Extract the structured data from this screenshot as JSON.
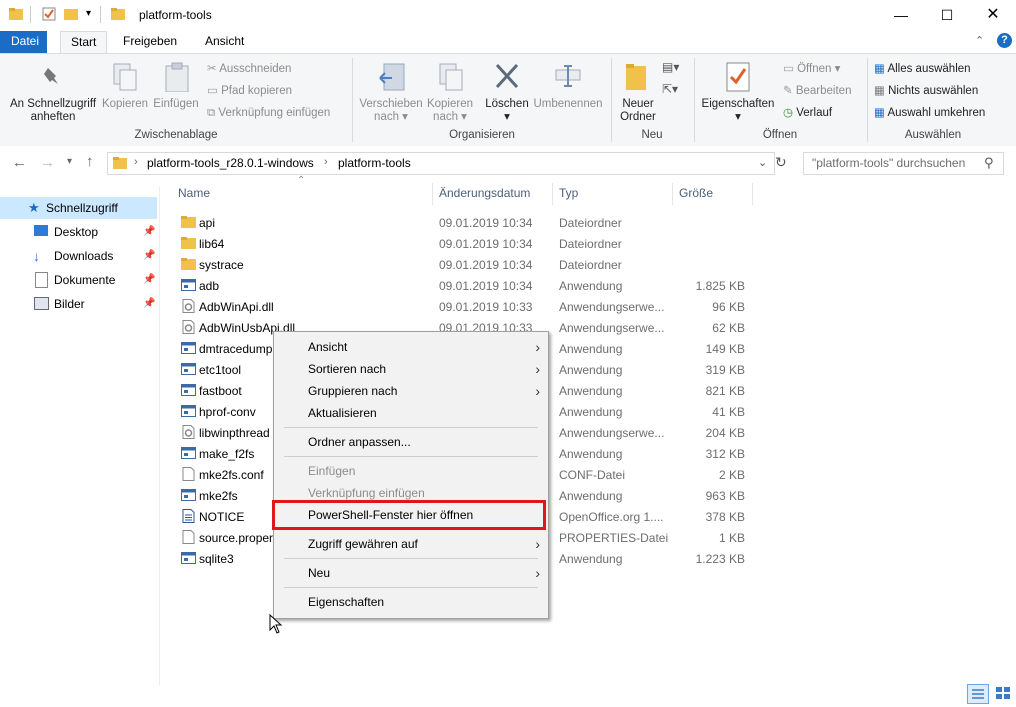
{
  "window": {
    "title": "platform-tools",
    "controls": {
      "minimize": "—",
      "maximize": "☐",
      "close": "✕"
    }
  },
  "ribbon_tabs": [
    "Datei",
    "Start",
    "Freigeben",
    "Ansicht"
  ],
  "ribbon": {
    "clipboard": {
      "pin_label_1": "An Schnellzugriff",
      "pin_label_2": "anheften",
      "copy": "Kopieren",
      "paste": "Einfügen",
      "cut": "Ausschneiden",
      "copy_path": "Pfad kopieren",
      "paste_shortcut": "Verknüpfung einfügen",
      "group": "Zwischenablage"
    },
    "organize": {
      "move_1": "Verschieben",
      "move_2": "nach",
      "copyto_1": "Kopieren",
      "copyto_2": "nach",
      "delete": "Löschen",
      "rename": "Umbenennen",
      "group": "Organisieren"
    },
    "new": {
      "folder_1": "Neuer",
      "folder_2": "Ordner",
      "group": "Neu"
    },
    "open": {
      "properties": "Eigenschaften",
      "open": "Öffnen",
      "edit": "Bearbeiten",
      "history": "Verlauf",
      "group": "Öffnen"
    },
    "select": {
      "all": "Alles auswählen",
      "none": "Nichts auswählen",
      "invert": "Auswahl umkehren",
      "group": "Auswählen"
    }
  },
  "address": {
    "crumbs": [
      "platform-tools_r28.0.1-windows",
      "platform-tools"
    ],
    "search_placeholder": "\"platform-tools\" durchsuchen"
  },
  "sidebar": {
    "quick_access": "Schnellzugriff",
    "items": [
      "Desktop",
      "Downloads",
      "Dokumente",
      "Bilder"
    ]
  },
  "columns": {
    "name": "Name",
    "date": "Änderungsdatum",
    "type": "Typ",
    "size": "Größe"
  },
  "files": [
    {
      "name": "api",
      "date": "09.01.2019 10:34",
      "type": "Dateiordner",
      "size": "",
      "icon": "folder"
    },
    {
      "name": "lib64",
      "date": "09.01.2019 10:34",
      "type": "Dateiordner",
      "size": "",
      "icon": "folder"
    },
    {
      "name": "systrace",
      "date": "09.01.2019 10:34",
      "type": "Dateiordner",
      "size": "",
      "icon": "folder"
    },
    {
      "name": "adb",
      "date": "09.01.2019 10:34",
      "type": "Anwendung",
      "size": "1.825 KB",
      "icon": "exe"
    },
    {
      "name": "AdbWinApi.dll",
      "date": "09.01.2019 10:33",
      "type": "Anwendungserwe...",
      "size": "96 KB",
      "icon": "dll"
    },
    {
      "name": "AdbWinUsbApi.dll",
      "date": "09.01.2019 10:33",
      "type": "Anwendungserwe...",
      "size": "62 KB",
      "icon": "dll"
    },
    {
      "name": "dmtracedump",
      "date": "",
      "type": "Anwendung",
      "size": "149 KB",
      "icon": "exe"
    },
    {
      "name": "etc1tool",
      "date": "",
      "type": "Anwendung",
      "size": "319 KB",
      "icon": "exe"
    },
    {
      "name": "fastboot",
      "date": "",
      "type": "Anwendung",
      "size": "821 KB",
      "icon": "exe"
    },
    {
      "name": "hprof-conv",
      "date": "",
      "type": "Anwendung",
      "size": "41 KB",
      "icon": "exe"
    },
    {
      "name": "libwinpthread",
      "date": "",
      "type": "Anwendungserwe...",
      "size": "204 KB",
      "icon": "dll"
    },
    {
      "name": "make_f2fs",
      "date": "",
      "type": "Anwendung",
      "size": "312 KB",
      "icon": "exe"
    },
    {
      "name": "mke2fs.conf",
      "date": "",
      "type": "CONF-Datei",
      "size": "2 KB",
      "icon": "file"
    },
    {
      "name": "mke2fs",
      "date": "",
      "type": "Anwendung",
      "size": "963 KB",
      "icon": "exe"
    },
    {
      "name": "NOTICE",
      "date": "",
      "type": "OpenOffice.org 1....",
      "size": "378 KB",
      "icon": "doc"
    },
    {
      "name": "source.proper",
      "date": "",
      "type": "PROPERTIES-Datei",
      "size": "1 KB",
      "icon": "file"
    },
    {
      "name": "sqlite3",
      "date": "",
      "type": "Anwendung",
      "size": "1.223 KB",
      "icon": "exe"
    }
  ],
  "context_menu": [
    {
      "label": "Ansicht",
      "submenu": true
    },
    {
      "label": "Sortieren nach",
      "submenu": true
    },
    {
      "label": "Gruppieren nach",
      "submenu": true
    },
    {
      "label": "Aktualisieren"
    },
    {
      "label": "Ordner anpassen..."
    },
    {
      "label": "Einfügen",
      "disabled": true
    },
    {
      "label": "Verknüpfung einfügen",
      "disabled": true
    },
    {
      "label": "PowerShell-Fenster hier öffnen",
      "highlighted": true
    },
    {
      "label": "Zugriff gewähren auf",
      "submenu": true
    },
    {
      "label": "Neu",
      "submenu": true
    },
    {
      "label": "Eigenschaften"
    }
  ],
  "colors": {
    "accent": "#1a6cc5",
    "highlight_border": "#e0161c",
    "folder": "#f0c24b"
  }
}
